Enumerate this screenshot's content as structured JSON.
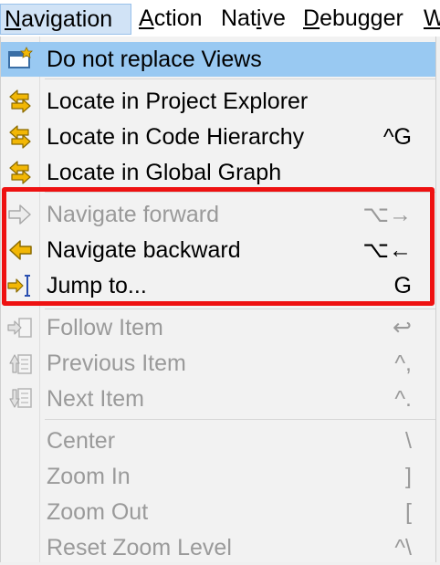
{
  "menubar": {
    "items": [
      {
        "label": "Navigation",
        "mnemonic_prefix": "",
        "mnemonic": "N",
        "rest": "avigation"
      },
      {
        "label": "Action",
        "mnemonic_prefix": "",
        "mnemonic": "A",
        "rest": "ction"
      },
      {
        "label": "Native",
        "mnemonic_prefix": "Nat",
        "mnemonic": "i",
        "rest": "ve"
      },
      {
        "label": "Debugger",
        "mnemonic_prefix": "",
        "mnemonic": "D",
        "rest": "ebugger"
      },
      {
        "label": "W",
        "mnemonic_prefix": "",
        "mnemonic": "W",
        "rest": ""
      }
    ]
  },
  "menu": {
    "items": [
      {
        "label": "Do not replace Views",
        "shortcut": "",
        "icon": "pin-view-icon",
        "enabled": true,
        "selected": true
      },
      {
        "label": "Locate in Project Explorer",
        "shortcut": "",
        "icon": "locate-arrows-icon",
        "enabled": true
      },
      {
        "label": "Locate in Code Hierarchy",
        "shortcut": "^G",
        "icon": "locate-arrows-icon",
        "enabled": true
      },
      {
        "label": "Locate in Global Graph",
        "shortcut": "",
        "icon": "locate-arrows-icon",
        "enabled": true
      },
      {
        "label": "Navigate forward",
        "shortcut": "⌥→",
        "icon": "arrow-right-icon",
        "enabled": false
      },
      {
        "label": "Navigate backward",
        "shortcut": "⌥←",
        "icon": "arrow-left-icon",
        "enabled": true
      },
      {
        "label": "Jump to...",
        "shortcut": "G",
        "icon": "jump-to-icon",
        "enabled": true
      },
      {
        "label": "Follow Item",
        "shortcut": "↩",
        "icon": "follow-item-icon",
        "enabled": false
      },
      {
        "label": "Previous Item",
        "shortcut": "^,",
        "icon": "previous-item-icon",
        "enabled": false
      },
      {
        "label": "Next Item",
        "shortcut": "^.",
        "icon": "next-item-icon",
        "enabled": false
      },
      {
        "label": "Center",
        "shortcut": "\\",
        "icon": "",
        "enabled": false
      },
      {
        "label": "Zoom In",
        "shortcut": "]",
        "icon": "",
        "enabled": false
      },
      {
        "label": "Zoom Out",
        "shortcut": "[",
        "icon": "",
        "enabled": false
      },
      {
        "label": "Reset Zoom Level",
        "shortcut": "^\\",
        "icon": "",
        "enabled": false
      }
    ]
  },
  "colors": {
    "selected_bg": "#99c9f2",
    "disabled_text": "#9a9a9a",
    "annotation_border": "#ee1111",
    "icon_yellow": "#f2b705"
  }
}
